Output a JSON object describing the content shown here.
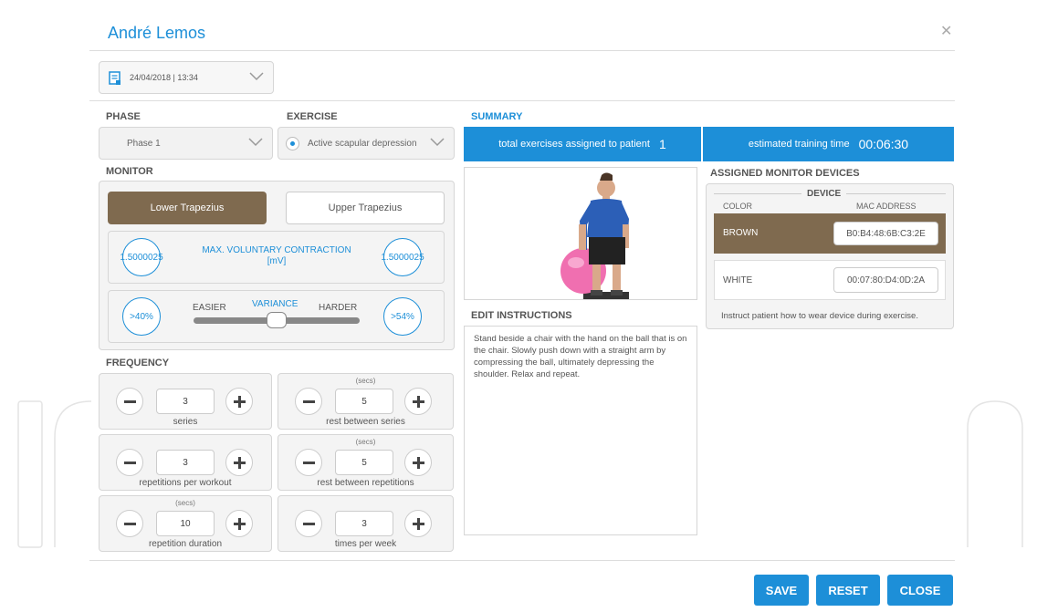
{
  "window": {
    "title": "André Lemos",
    "close_icon": "close-icon"
  },
  "session": {
    "date_value": "24/04/2018 | 13:34"
  },
  "phase": {
    "label": "PHASE",
    "value": "Phase 1"
  },
  "exercise": {
    "label": "EXERCISE",
    "value": "Active scapular depression"
  },
  "monitor": {
    "label": "MONITOR",
    "muscles": [
      {
        "label": "Lower Trapezius",
        "selected": true
      },
      {
        "label": "Upper Trapezius",
        "selected": false
      }
    ],
    "mvc": {
      "label_line1": "MAX. VOLUNTARY CONTRACTION",
      "label_line2": "[mV]",
      "left_value": "1.5000025",
      "right_value": "1.5000025"
    },
    "variance": {
      "label": "VARIANCE",
      "easier_label": "EASIER",
      "harder_label": "HARDER",
      "left_value": ">40%",
      "right_value": ">54%",
      "slider_position": 0.5
    }
  },
  "frequency": {
    "label": "FREQUENCY",
    "items": [
      {
        "label": "series",
        "sub": "",
        "value": "3"
      },
      {
        "label": "rest between series",
        "sub": "(secs)",
        "value": "5"
      },
      {
        "label": "repetitions per workout",
        "sub": "",
        "value": "3"
      },
      {
        "label": "rest between repetitions",
        "sub": "(secs)",
        "value": "5"
      },
      {
        "label": "repetition duration",
        "sub": "(secs)",
        "value": "10"
      },
      {
        "label": "times per week",
        "sub": "",
        "value": "3"
      }
    ]
  },
  "summary": {
    "label": "SUMMARY",
    "total_label": "total exercises assigned to patient",
    "total_value": "1",
    "time_label": "estimated training time",
    "time_value": "00:06:30"
  },
  "instructions": {
    "label": "EDIT INSTRUCTIONS",
    "text": "Stand beside a chair with the hand on the ball that is on the chair. Slowly push down with a straight arm by compressing the ball, ultimately depressing the shoulder. Relax and repeat."
  },
  "devices": {
    "label": "ASSIGNED MONITOR DEVICES",
    "group_label": "DEVICE",
    "color_header": "COLOR",
    "mac_header": "MAC ADDRESS",
    "rows": [
      {
        "color": "BROWN",
        "mac": "B0:B4:48:6B:C3:2E",
        "highlight": true
      },
      {
        "color": "WHITE",
        "mac": "00:07:80:D4:0D:2A",
        "highlight": false
      }
    ],
    "note": "Instruct patient how to wear device during exercise."
  },
  "footer": {
    "save": "SAVE",
    "reset": "RESET",
    "close": "CLOSE"
  },
  "colors": {
    "accent": "#1d8fd8",
    "brown": "#7f6a4f",
    "ball": "#f06fb0"
  }
}
